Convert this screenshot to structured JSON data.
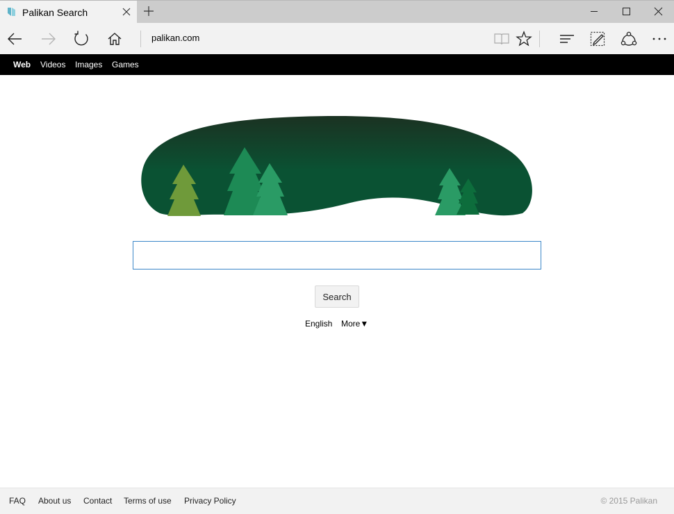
{
  "browser": {
    "tab_title": "Palikan Search",
    "address": "palikan.com",
    "icons": {
      "favicon": "palikan-favicon",
      "tab_close": "close-icon",
      "new_tab": "plus-icon",
      "minimize": "minimize-icon",
      "maximize": "maximize-icon",
      "close": "close-icon",
      "back": "back-arrow-icon",
      "forward": "forward-arrow-icon",
      "refresh": "refresh-icon",
      "home": "home-icon",
      "reading_view": "book-icon",
      "favorite": "star-icon",
      "hub": "hub-icon",
      "web_note": "pen-icon",
      "share": "share-icon",
      "more": "more-icon"
    }
  },
  "site_nav": {
    "items": [
      {
        "label": "Web",
        "active": true
      },
      {
        "label": "Videos"
      },
      {
        "label": "Images"
      },
      {
        "label": "Games"
      }
    ]
  },
  "search": {
    "value": "",
    "button_label": "Search"
  },
  "options": {
    "language": "English",
    "more": "More▼"
  },
  "footer": {
    "links": [
      "FAQ",
      "About us",
      "Contact",
      "Terms of use",
      "Privacy Policy"
    ],
    "copyright": "© 2015 Palikan"
  },
  "colors": {
    "hero_dark": "#1b3222",
    "hero_mid": "#0a5233",
    "tree_olive": "#6f9a3a",
    "tree_green": "#1d8a55",
    "tree_light": "#2a9b65",
    "tree_dark": "#0d6d3c"
  }
}
